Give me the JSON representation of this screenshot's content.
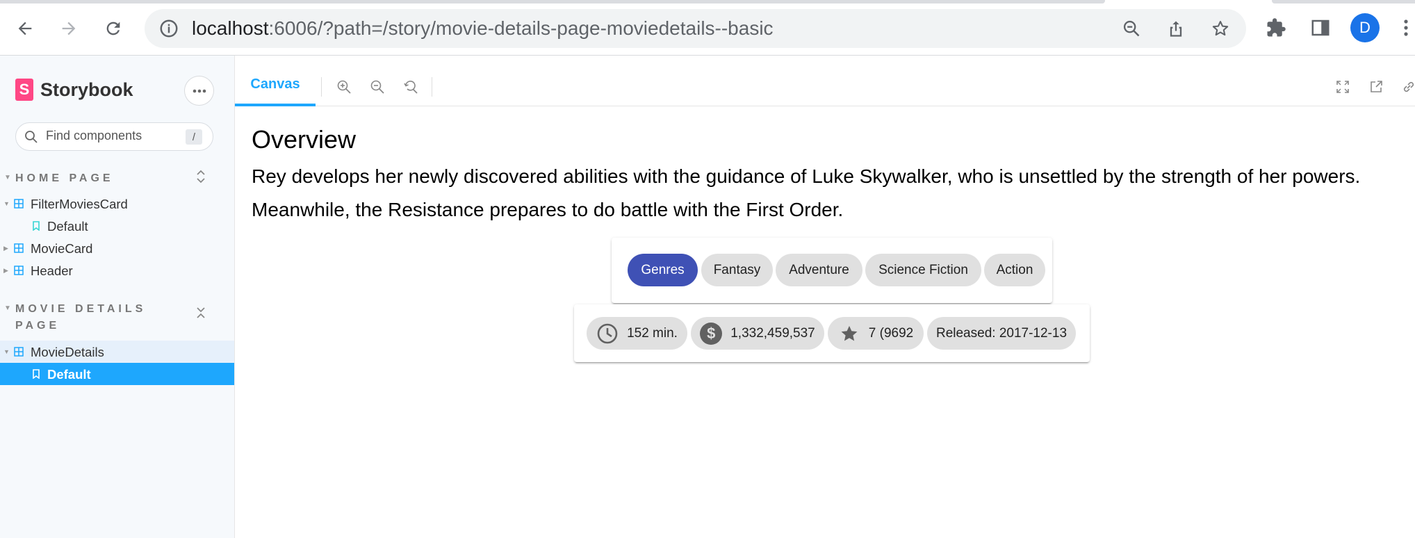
{
  "browser": {
    "url_host": "localhost",
    "url_rest": ":6006/?path=/story/movie-details-page-moviedetails--basic",
    "avatar_letter": "D",
    "colors": {
      "avatar": "#1a73e8",
      "omnibox": "#f1f3f4"
    }
  },
  "sidebar": {
    "brand": "Storybook",
    "search_placeholder": "Find components",
    "search_shortcut": "/",
    "groups": [
      {
        "title": "HOME PAGE",
        "items": [
          {
            "label": "FilterMoviesCard",
            "stories": [
              {
                "label": "Default"
              }
            ]
          },
          {
            "label": "MovieCard"
          },
          {
            "label": "Header"
          }
        ]
      },
      {
        "title_line1": "MOVIE DETAILS",
        "title_line2": "PAGE",
        "items": [
          {
            "label": "MovieDetails",
            "stories": [
              {
                "label": "Default",
                "selected": true
              }
            ]
          }
        ]
      }
    ],
    "colors": {
      "brand": "#ff4785",
      "selected": "#1ea7fd",
      "highlight": "#e6f0fb"
    }
  },
  "toolbar": {
    "tabs": [
      {
        "label": "Canvas",
        "active": true
      }
    ],
    "tools": [
      "zoom-in-icon",
      "zoom-out-icon",
      "reset-zoom-icon"
    ],
    "right_tools": [
      "fullscreen-icon",
      "open-new-tab-icon",
      "copy-link-icon"
    ]
  },
  "story": {
    "overview_title": "Overview",
    "overview_text": "Rey develops her newly discovered abilities with the guidance of Luke Skywalker, who is unsettled by the strength of her powers. Meanwhile, the Resistance prepares to do battle with the First Order.",
    "genres_label": "Genres",
    "genres": [
      "Fantasy",
      "Adventure",
      "Science Fiction",
      "Action"
    ],
    "runtime": "152 min.",
    "revenue": "1,332,459,537",
    "rating": "7 (9692",
    "released": "Released: 2017-12-13",
    "colors": {
      "primary_chip": "#3f51b5",
      "chip": "#e0e0e0"
    }
  }
}
